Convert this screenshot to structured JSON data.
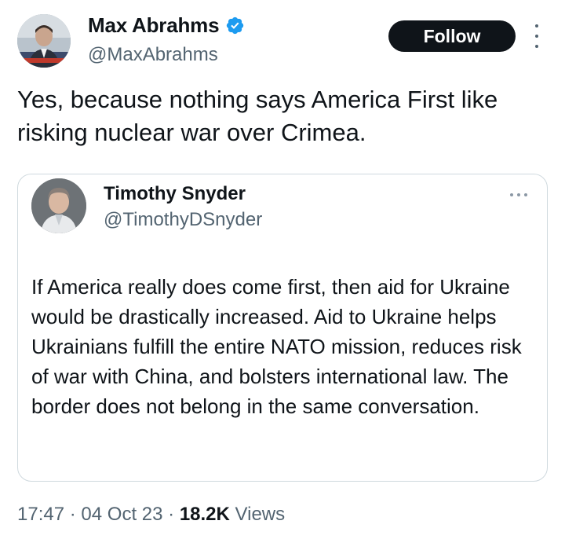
{
  "author": {
    "name": "Max Abrahms",
    "handle": "@MaxAbrahms"
  },
  "follow_label": "Follow",
  "tweet_text": "Yes, because nothing says America First like risking nuclear war over Crimea.",
  "quoted": {
    "name": "Timothy Snyder",
    "handle": "@TimothyDSnyder",
    "text": "If America really does come first, then aid for Ukraine would be drastically increased. Aid to Ukraine helps Ukrainians fulfill the entire NATO mission, reduces risk of war with China, and bolsters international law. The border does not belong in the same conversation."
  },
  "meta": {
    "time": "17:47",
    "separator": "·",
    "date": "04 Oct 23",
    "views_count": "18.2K",
    "views_label": "Views"
  },
  "colors": {
    "accent": "#1d9bf0",
    "text": "#0f1419",
    "secondary": "#536471",
    "border": "#cfd9de"
  },
  "icons": {
    "verified": "verified-badge-icon",
    "more": "more-options-icon"
  }
}
